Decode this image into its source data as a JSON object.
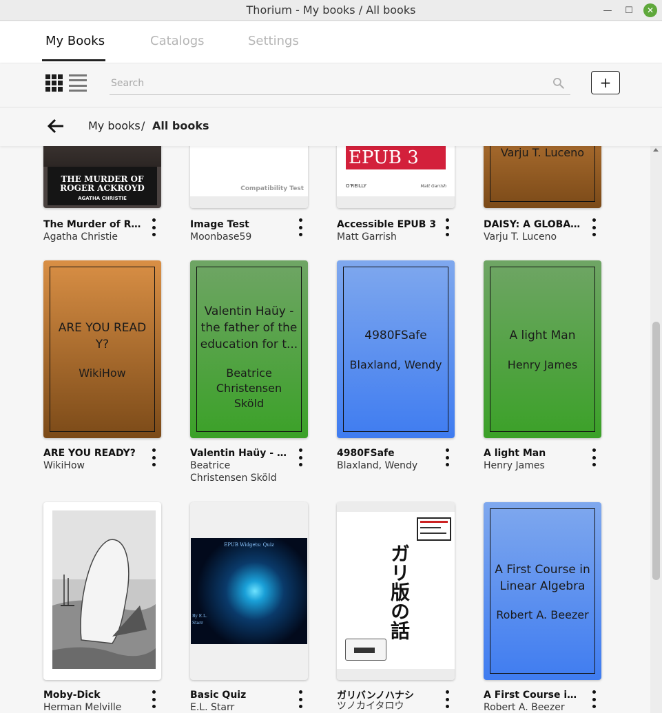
{
  "window": {
    "title": "Thorium - My books / All books",
    "minimize": "—",
    "maximize": "☐",
    "close": "✕"
  },
  "nav": {
    "tabs": [
      {
        "label": "My Books",
        "active": true
      },
      {
        "label": "Catalogs",
        "active": false
      },
      {
        "label": "Settings",
        "active": false
      }
    ]
  },
  "toolbar": {
    "search_placeholder": "Search",
    "search_value": "",
    "add_label": "+",
    "view_mode": "grid"
  },
  "breadcrumb": {
    "parent": "My books",
    "separator": "/",
    "current": "All books"
  },
  "books": [
    {
      "title": "The Murder of Ro...",
      "author": "Agatha Christie",
      "cover_lines": [
        "THE MURDER OF",
        "ROGER ACKROYD",
        "AGATHA CHRISTIE"
      ]
    },
    {
      "title": "Image Test",
      "author": "Moonbase59",
      "cover_caption": "Compatibility Test"
    },
    {
      "title": "Accessible EPUB 3",
      "author": "Matt Garrish",
      "cover_title": "EPUB 3",
      "cover_publisher": "O'REILLY",
      "cover_author": "Matt Garrish"
    },
    {
      "title": "DAISY: A GLOBAL ...",
      "author": "Varju T. Luceno",
      "cover_author": "Varju T. Luceno"
    },
    {
      "title": "ARE YOU READY?",
      "author": "WikiHow",
      "cover_title": "ARE YOU READ Y?",
      "cover_author": "WikiHow"
    },
    {
      "title": "Valentin Haüy - th...",
      "author": "Beatrice Christensen Sköld",
      "cover_title": "Valentin Haüy - the father of the education for t...",
      "cover_author": "Beatrice Christensen Sköld"
    },
    {
      "title": "4980FSafe",
      "author": "Blaxland, Wendy",
      "cover_title": "4980FSafe",
      "cover_author": "Blaxland, Wendy"
    },
    {
      "title": "A light Man",
      "author": "Henry James",
      "cover_title": "A light Man",
      "cover_author": "Henry James"
    },
    {
      "title": "Moby-Dick",
      "author": "Herman Melville"
    },
    {
      "title": "Basic Quiz",
      "author": "E.L. Starr",
      "cover_title": "EPUB Widgets: Quiz",
      "cover_byline": "By E.L. Starr"
    },
    {
      "title": "ガリバンノハナシ",
      "author": "ツノカイタロウ",
      "cover_title": "ガリ版の話"
    },
    {
      "title": "A First Course in L...",
      "author": "Robert A. Beezer",
      "cover_title": "A First Course in Linear Algebra",
      "cover_author": "Robert A. Beezer"
    }
  ],
  "colors": {
    "brown_cover": "#b0702e",
    "green_cover": "#55a347",
    "blue_cover": "#5c8ff0",
    "close_button": "#5fa83b"
  },
  "icons": [
    "grid-view-icon",
    "list-view-icon",
    "search-icon",
    "back-arrow-icon",
    "more-vert-icon"
  ]
}
